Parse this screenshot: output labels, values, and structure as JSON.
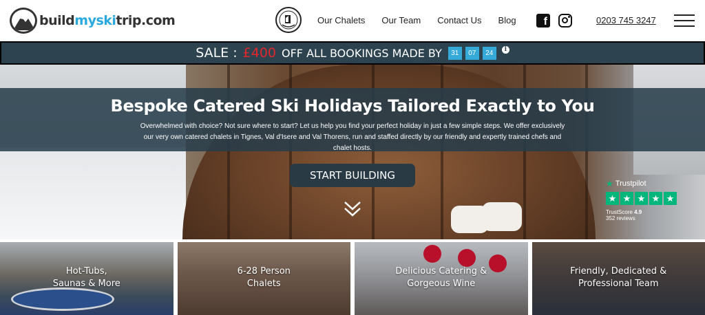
{
  "header": {
    "logo": {
      "part1": "build",
      "part2": "myski",
      "part3": "trip.com"
    },
    "abta_badge_icon": "abta-protected-badge",
    "nav": [
      {
        "label": "Our Chalets"
      },
      {
        "label": "Our Team"
      },
      {
        "label": "Contact Us"
      },
      {
        "label": "Blog"
      }
    ],
    "social_icons": [
      "facebook-icon",
      "instagram-icon"
    ],
    "phone": "0203 745 3247",
    "menu_icon": "hamburger-menu-icon"
  },
  "sale_banner": {
    "prefix": "SALE :",
    "amount": "£400",
    "text": "OFF ALL BOOKINGS MADE BY",
    "date": [
      "31",
      "07",
      "24"
    ],
    "info_icon": "info-icon",
    "colors": {
      "background": "#2d4450",
      "amount": "#e4262b",
      "date_box": "#35a9d8"
    }
  },
  "hero": {
    "title": "Bespoke Catered Ski Holidays Tailored Exactly to You",
    "subtitle": "Overwhelmed with choice? Not sure where to start? Let us help you find your perfect holiday in just a few simple steps. We offer exclusively our very own catered chalets in Tignes, Val d'Isere and Val Thorens, run and staffed directly by our friendly and expertly trained chefs and chalet hosts.",
    "cta_label": "START BUILDING",
    "scroll_icon": "double-chevron-down-icon",
    "trustpilot": {
      "brand": "Trustpilot",
      "stars": 5,
      "score_label": "TrustScore",
      "score": "4.9",
      "reviews": "352 reviews",
      "color": "#00b67a"
    }
  },
  "tiles": [
    {
      "line1": "Hot-Tubs,",
      "line2": "Saunas & More"
    },
    {
      "line1": "6-28 Person",
      "line2": "Chalets"
    },
    {
      "line1": "Delicious Catering &",
      "line2": "Gorgeous Wine"
    },
    {
      "line1": "Friendly, Dedicated &",
      "line2": "Professional Team"
    }
  ]
}
